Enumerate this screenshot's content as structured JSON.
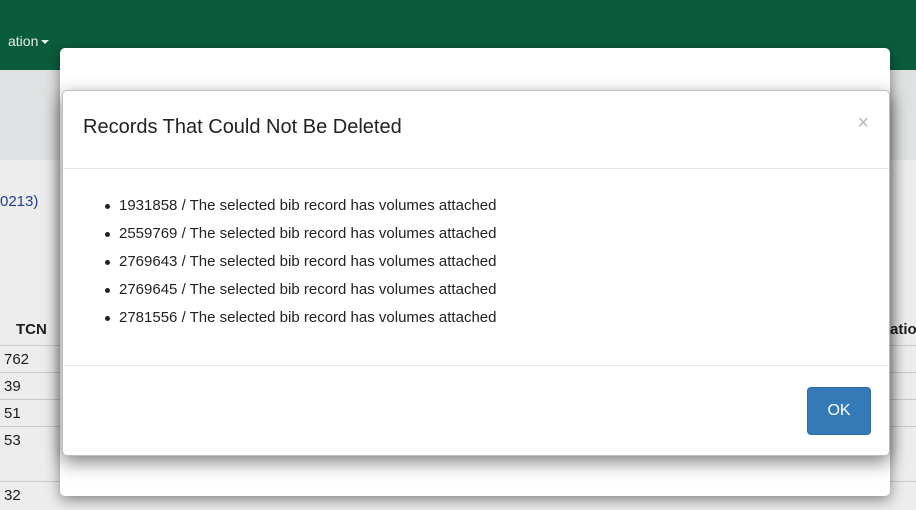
{
  "navbar": {
    "menu_label": "ation",
    "bg_color": "#0b5c3d"
  },
  "background": {
    "record_id_fragment": "0213)",
    "table": {
      "tcn_header": "TCN",
      "right_header": "atio",
      "rows": [
        "762",
        "39",
        "51",
        "53",
        "32"
      ]
    }
  },
  "modal": {
    "title": "Records That Could Not Be Deleted",
    "close_label": "×",
    "errors": [
      "1931858 / The selected bib record has volumes attached",
      "2559769 / The selected bib record has volumes attached",
      "2769643 / The selected bib record has volumes attached",
      "2769645 / The selected bib record has volumes attached",
      "2781556 / The selected bib record has volumes attached"
    ],
    "ok_label": "OK",
    "ok_color": "#337ab7"
  }
}
